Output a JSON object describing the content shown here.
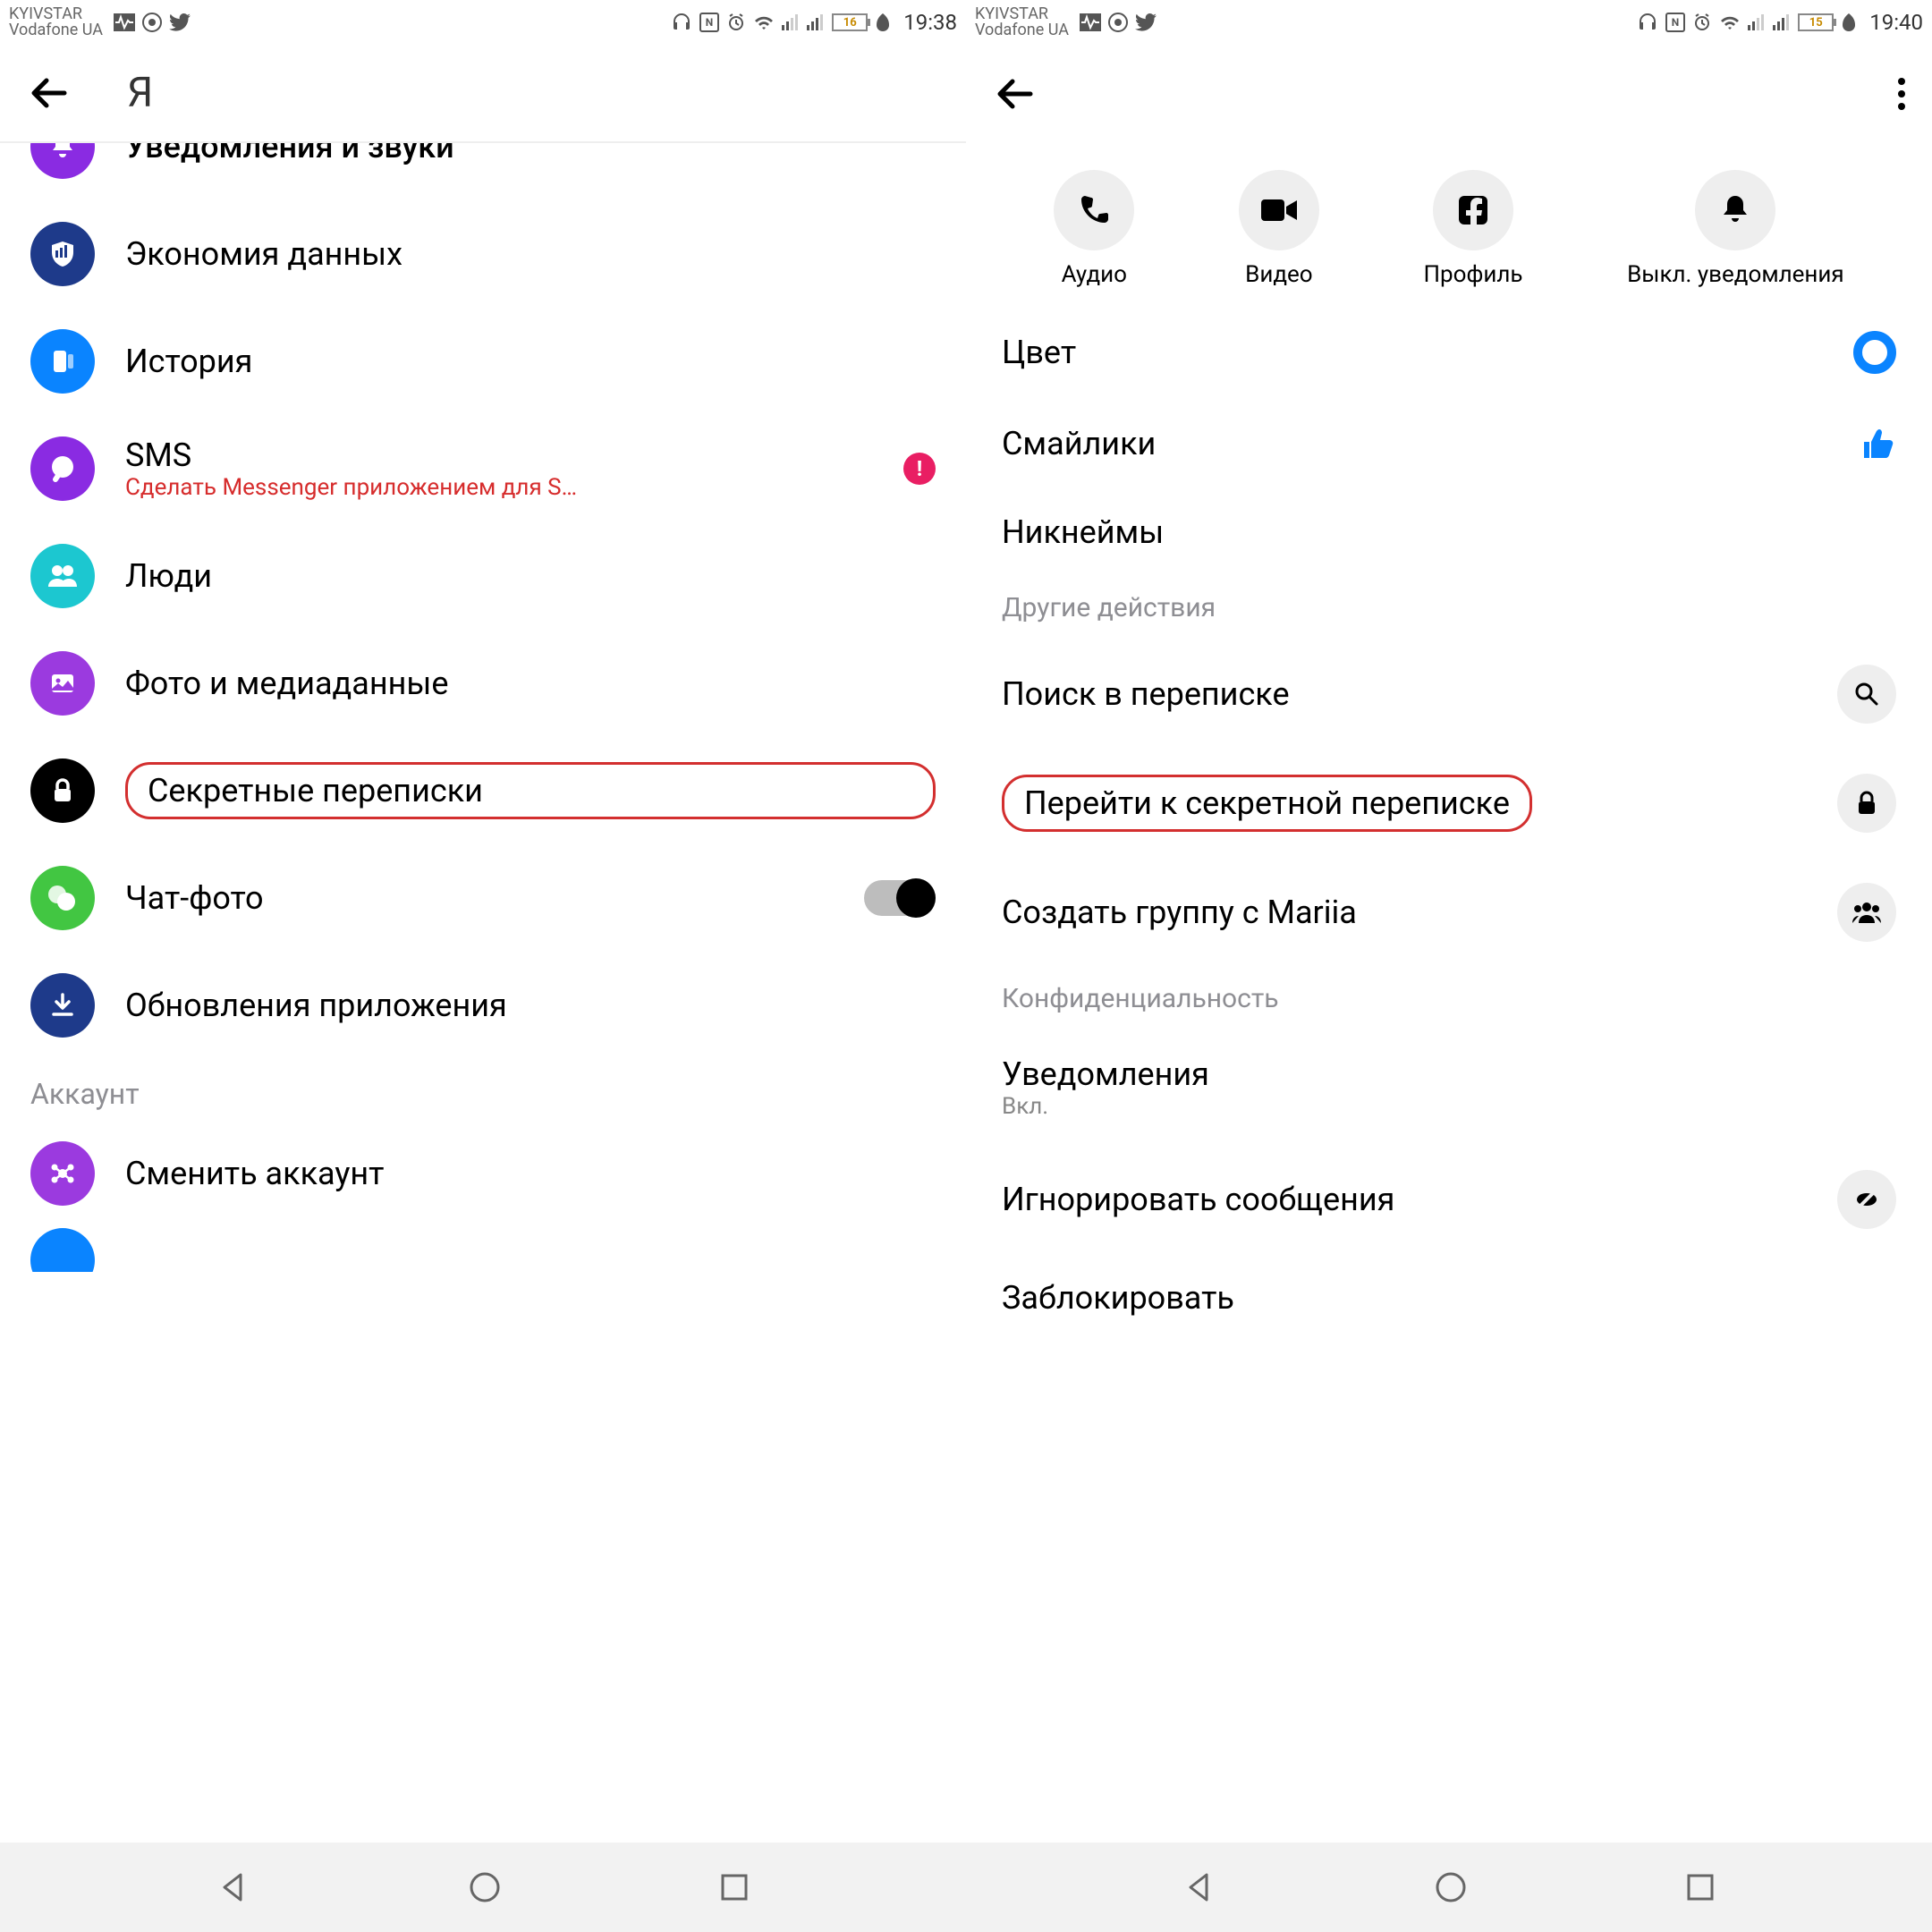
{
  "status": {
    "carrier1": "KYIVSTAR",
    "carrier2": "Vodafone UA",
    "left": {
      "battery": "16",
      "time": "19:38"
    },
    "right": {
      "battery": "15",
      "time": "19:40"
    }
  },
  "left_screen": {
    "header_title": "Я",
    "items": [
      {
        "label": "Уведомления и звуки",
        "icon": "bell",
        "color": "purple",
        "cut": true
      },
      {
        "label": "Экономия данных",
        "icon": "shield",
        "color": "darkblue"
      },
      {
        "label": "История",
        "icon": "story",
        "color": "blue"
      },
      {
        "label": "SMS",
        "sublabel": "Сделать Messenger приложением для S…",
        "icon": "chat",
        "color": "purple",
        "alert": true
      },
      {
        "label": "Люди",
        "icon": "people",
        "color": "cyan"
      },
      {
        "label": "Фото и медиаданные",
        "icon": "photo",
        "color": "medpurple"
      },
      {
        "label": "Секретные переписки",
        "icon": "lock",
        "color": "black",
        "highlight": true
      },
      {
        "label": "Чат-фото",
        "icon": "chatphoto",
        "color": "green",
        "toggle": true
      },
      {
        "label": "Обновления приложения",
        "icon": "download",
        "color": "darkblue"
      }
    ],
    "section_title": "Аккаунт",
    "account_items": [
      {
        "label": "Сменить аккаунт",
        "icon": "switch",
        "color": "medpurple"
      }
    ]
  },
  "right_screen": {
    "actions": [
      {
        "label": "Аудио",
        "icon": "phone"
      },
      {
        "label": "Видео",
        "icon": "video"
      },
      {
        "label": "Профиль",
        "icon": "fb"
      },
      {
        "label": "Выкл. уведомления",
        "icon": "bell"
      }
    ],
    "settings1": [
      {
        "label": "Цвет",
        "trailing": "color"
      },
      {
        "label": "Смайлики",
        "trailing": "like"
      },
      {
        "label": "Никнеймы"
      }
    ],
    "section1": "Другие действия",
    "settings2": [
      {
        "label": "Поиск в переписке",
        "trailing": "search"
      },
      {
        "label": "Перейти к секретной переписке",
        "trailing": "lock",
        "highlight": true
      },
      {
        "label": "Создать группу с Mariia",
        "trailing": "group"
      }
    ],
    "section2": "Конфиденциальность",
    "settings3": [
      {
        "label": "Уведомления",
        "sublabel": "Вкл."
      },
      {
        "label": "Игнорировать сообщения",
        "trailing": "ignore"
      },
      {
        "label": "Заблокировать"
      }
    ]
  }
}
